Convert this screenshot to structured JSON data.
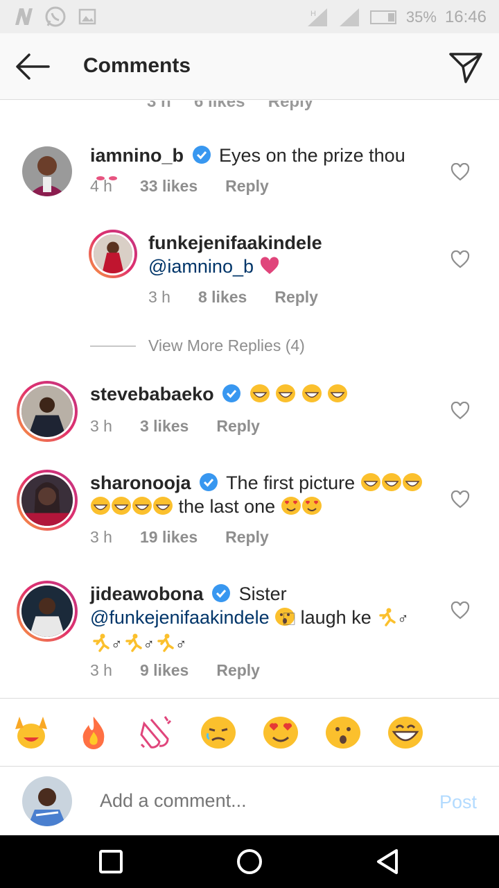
{
  "status": {
    "battery": "35%",
    "time": "16:46",
    "network": "H"
  },
  "header": {
    "title": "Comments"
  },
  "comments": [
    {
      "user": "iamnino_b",
      "text": "Eyes on the prize thou",
      "time": "4 h",
      "likes": "33 likes",
      "reply": "Reply"
    },
    {
      "user": "funkejenifaakindele",
      "mention": "@iamnino_b",
      "time": "3 h",
      "likes": "8 likes",
      "reply": "Reply"
    },
    {
      "user": "stevebabaeko",
      "time": "3 h",
      "likes": "3 likes",
      "reply": "Reply"
    },
    {
      "user": "sharonooja",
      "text1": "The first picture",
      "text2": "the last one",
      "time": "3 h",
      "likes": "19 likes",
      "reply": "Reply"
    },
    {
      "user": "jideawobona",
      "text1": "Sister",
      "mention": "@funkejenifaakindele",
      "text2": "laugh ke",
      "time": "3 h",
      "likes": "9 likes",
      "reply": "Reply"
    }
  ],
  "view_more": "View More Replies (4)",
  "quick_emojis": [
    "raising-hands",
    "fire",
    "clapping-hands",
    "crying-face",
    "heart-eyes",
    "surprised-face",
    "grinning-face"
  ],
  "input": {
    "placeholder": "Add a comment...",
    "post_label": "Post"
  },
  "colors": {
    "accent": "#3897f0",
    "mention": "#003569",
    "post_disabled": "#b3dbff",
    "muted": "#8e8e8e"
  }
}
